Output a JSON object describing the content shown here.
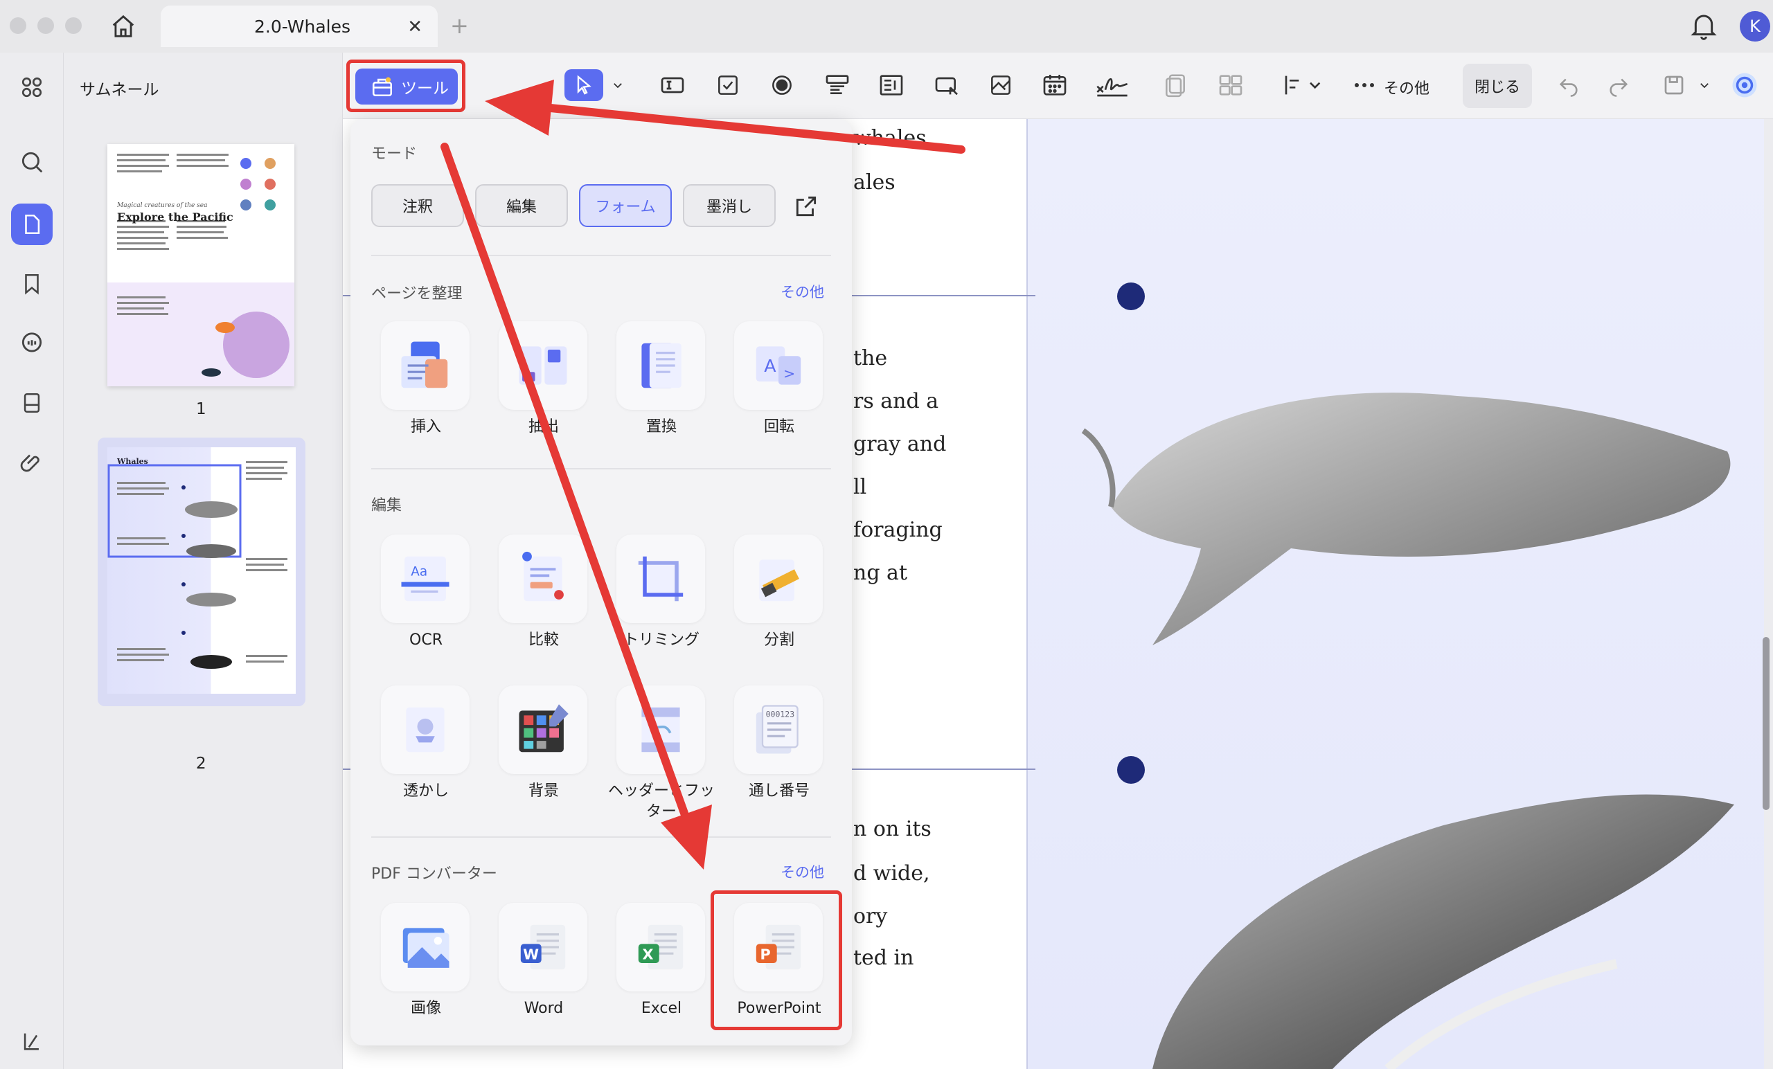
{
  "window": {
    "tab_title": "2.0-Whales",
    "avatar_letter": "K"
  },
  "thumbnails": {
    "panel_title": "サムネール",
    "pages": [
      {
        "number": "1",
        "heading": "Explore the Pacific",
        "subheading": "Magical creatures of the sea"
      },
      {
        "number": "2",
        "heading": "Whales"
      }
    ]
  },
  "toolbar": {
    "tools_label": "ツール",
    "more_label": "その他",
    "close_label": "閉じる"
  },
  "popup": {
    "mode_title": "モード",
    "modes": [
      "注釈",
      "編集",
      "フォーム",
      "墨消し"
    ],
    "active_mode": "フォーム",
    "organize": {
      "title": "ページを整理",
      "more": "その他",
      "items": [
        "挿入",
        "抽出",
        "置換",
        "回転"
      ]
    },
    "edit": {
      "title": "編集",
      "items": [
        "OCR",
        "比較",
        "トリミング",
        "分割",
        "透かし",
        "背景",
        "ヘッダーとフッター",
        "通し番号"
      ]
    },
    "converter": {
      "title": "PDF コンバーター",
      "more": "その他",
      "items": [
        "画像",
        "Word",
        "Excel",
        "PowerPoint"
      ]
    }
  },
  "document": {
    "fragments": [
      "whales",
      "ales",
      "the",
      "rs and a",
      "gray and",
      "ll",
      "foraging",
      "ng at",
      "n on its",
      "d wide,",
      "ory",
      "ted in"
    ]
  },
  "colors": {
    "accent": "#5b6cf0",
    "highlight": "#e53935",
    "timeline_dot": "#1e2a78"
  }
}
